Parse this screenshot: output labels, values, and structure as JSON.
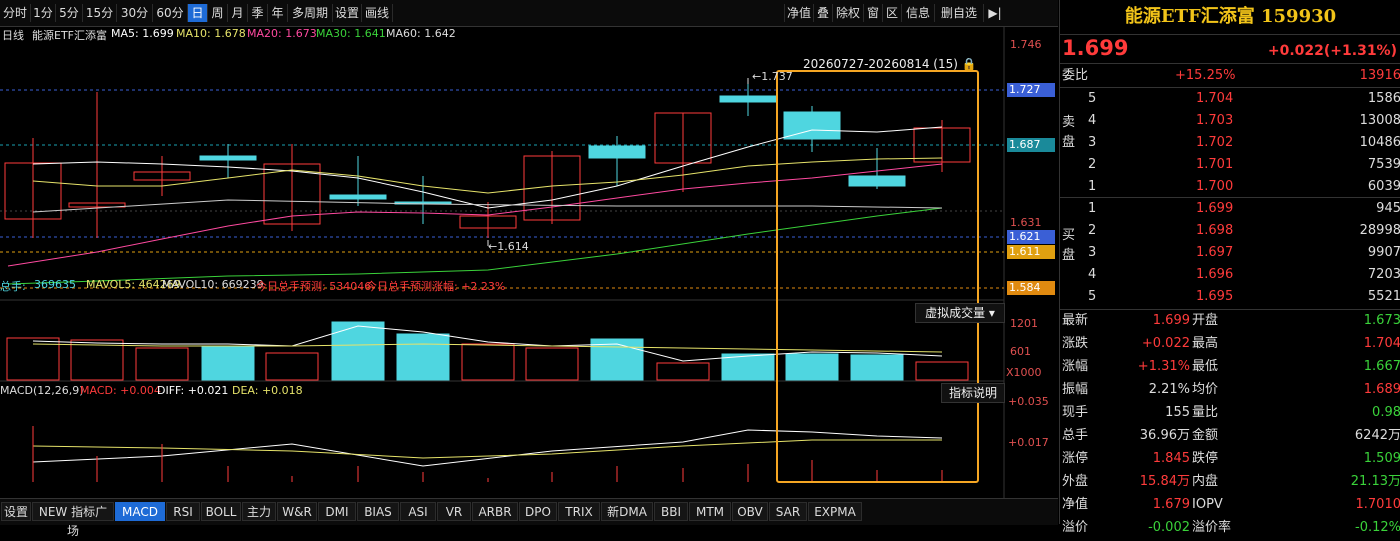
{
  "toolbar": {
    "periods": [
      "分时",
      "1分",
      "5分",
      "15分",
      "30分",
      "60分",
      "日",
      "周",
      "月",
      "季",
      "年",
      "多周期",
      "设置",
      "画线"
    ],
    "active_period": "日",
    "right": [
      "净值",
      "叠",
      "除权",
      "窗",
      "区",
      "信息",
      "删自选"
    ],
    "right_icon": "▶|"
  },
  "chart": {
    "header": {
      "period": "日线",
      "name": "能源ETF汇添富",
      "ma5": "MA5: 1.699",
      "ma10": "MA10: 1.678",
      "ma20": "MA20: 1.673",
      "ma30": "MA30: 1.641",
      "ma60": "MA60: 1.642"
    },
    "range_label": "20260727-20260814 (15)",
    "high_mark": "←1.737",
    "low_mark": "←1.614",
    "price_axis": {
      "p1746": "1.746",
      "p1631": "1.631"
    },
    "price_tags": {
      "t1727": "1.727",
      "t1687": "1.687",
      "t1621": "1.621",
      "t1611": "1.611",
      "t1584": "1.584"
    },
    "volume_header": {
      "label": "总手:",
      "value": "369635",
      "mavol5": "MAVOL5: 464269",
      "mavol10": "MAVOL10: 669239",
      "forecast": "今日总手预测: 534046",
      "forecast_rate": "今日总手预测涨幅: +2.23%"
    },
    "virtual_volume_label": "虚拟成交量 ▾",
    "vol_axis": {
      "v1": "1201",
      "v2": "601",
      "unit": "X1000"
    },
    "macd_header": {
      "title": "MACD(12,26,9)",
      "macd": "MACD: +0.004",
      "diff": "DIFF: +0.021",
      "dea": "DEA: +0.018"
    },
    "indicator_help": "指标说明",
    "macd_axis": {
      "m1": "+0.035",
      "m2": "+0.017"
    }
  },
  "bottom_tabs": [
    "设置",
    "NEW 指标广场",
    "MACD",
    "RSI",
    "BOLL",
    "主力",
    "W&R",
    "DMI",
    "BIAS",
    "ASI",
    "VR",
    "ARBR",
    "DPO",
    "TRIX",
    "新DMA",
    "BBI",
    "MTM",
    "OBV",
    "SAR",
    "EXPMA"
  ],
  "active_tab": "MACD",
  "quote": {
    "title": "能源ETF汇添富 159930",
    "price": "1.699",
    "change": "+0.022(+1.31%)",
    "weibi_label": "委比",
    "weibi_value": "+15.25%",
    "weibi_vol": "13916",
    "sell_label": "卖盘",
    "buy_label": "买盘",
    "sell": [
      {
        "n": "5",
        "p": "1.704",
        "v": "1586"
      },
      {
        "n": "4",
        "p": "1.703",
        "v": "13008"
      },
      {
        "n": "3",
        "p": "1.702",
        "v": "10486"
      },
      {
        "n": "2",
        "p": "1.701",
        "v": "7539"
      },
      {
        "n": "1",
        "p": "1.700",
        "v": "6039"
      }
    ],
    "buy": [
      {
        "n": "1",
        "p": "1.699",
        "v": "945"
      },
      {
        "n": "2",
        "p": "1.698",
        "v": "28998"
      },
      {
        "n": "3",
        "p": "1.697",
        "v": "9907"
      },
      {
        "n": "4",
        "p": "1.696",
        "v": "7203"
      },
      {
        "n": "5",
        "p": "1.695",
        "v": "5521"
      }
    ],
    "stats": [
      {
        "l1": "最新",
        "v1": "1.699",
        "l2": "开盘",
        "v2": "1.673"
      },
      {
        "l1": "涨跌",
        "v1": "+0.022",
        "l2": "最高",
        "v2": "1.704"
      },
      {
        "l1": "涨幅",
        "v1": "+1.31%",
        "l2": "最低",
        "v2": "1.667"
      },
      {
        "l1": "振幅",
        "v1": "2.21%",
        "l2": "均价",
        "v2": "1.689"
      },
      {
        "l1": "现手",
        "v1": "155",
        "l2": "量比",
        "v2": "0.98"
      },
      {
        "l1": "总手",
        "v1": "36.96万",
        "l2": "金额",
        "v2": "6242万"
      },
      {
        "l1": "涨停",
        "v1": "1.845",
        "l2": "跌停",
        "v2": "1.509"
      },
      {
        "l1": "外盘",
        "v1": "15.84万",
        "l2": "内盘",
        "v2": "21.13万"
      },
      {
        "l1": "净值",
        "v1": "1.679",
        "l2": "IOPV",
        "v2": "1.7010"
      },
      {
        "l1": "溢价",
        "v1": "-0.002",
        "l2": "溢价率",
        "v2": "-0.12%"
      }
    ]
  },
  "colors": {
    "up": "#ff3b3b",
    "down": "#4fd6e0",
    "ma5": "#ffffff",
    "ma10": "#e6e36a",
    "ma20": "#ff4aa0",
    "ma30": "#3ad23a",
    "ma60": "#cccccc",
    "highlight": "#f5a623",
    "accent": "#1e6bd6",
    "tag_blue": "#3a5fd6",
    "tag_teal": "#1a8a9a",
    "tag_orange": "#e08a10"
  }
}
